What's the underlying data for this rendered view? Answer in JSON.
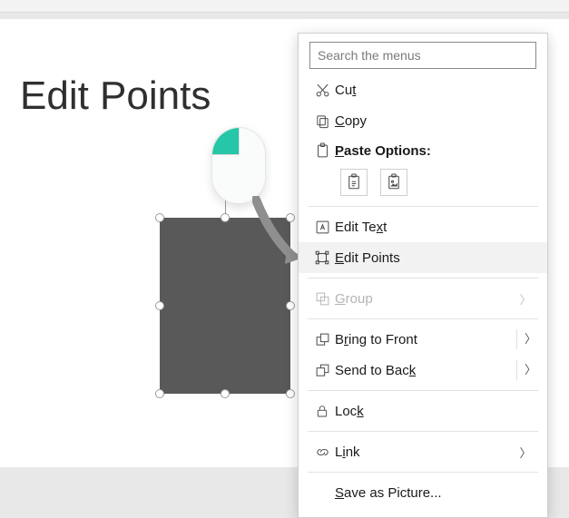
{
  "slide": {
    "title": "Edit Points"
  },
  "context_menu": {
    "search_placeholder": "Search the menus",
    "items": {
      "cut": {
        "pre": "Cu",
        "k": "t",
        "post": ""
      },
      "copy": {
        "pre": "",
        "k": "C",
        "post": "opy"
      },
      "paste_heading": {
        "pre": "",
        "k": "P",
        "post": "aste Options:"
      },
      "edit_text": {
        "pre": "Edit Te",
        "k": "x",
        "post": "t"
      },
      "edit_points": {
        "pre": "",
        "k": "E",
        "post": "dit Points"
      },
      "group": {
        "pre": "",
        "k": "G",
        "post": "roup"
      },
      "bring_to_front": {
        "pre": "B",
        "k": "r",
        "post": "ing to Front"
      },
      "send_to_back": {
        "pre": "Send to Bac",
        "k": "k",
        "post": ""
      },
      "lock": {
        "pre": "Loc",
        "k": "k",
        "post": ""
      },
      "link": {
        "pre": "L",
        "k": "i",
        "post": "nk"
      },
      "save_as_picture": {
        "pre": "",
        "k": "S",
        "post": "ave as Picture..."
      }
    }
  }
}
